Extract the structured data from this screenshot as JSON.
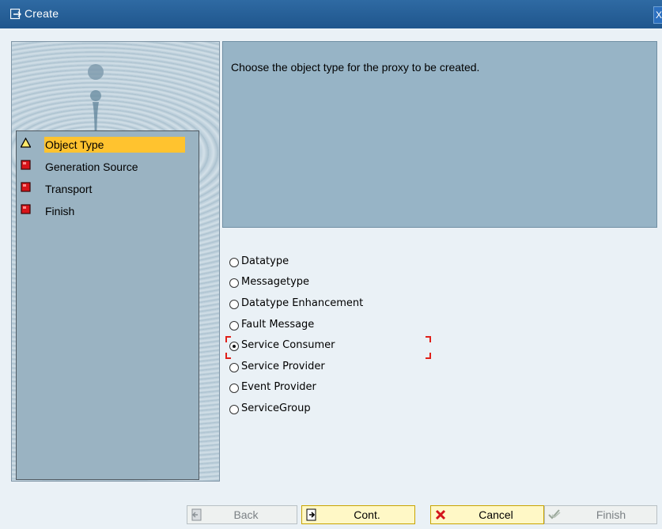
{
  "window": {
    "title": "Create",
    "close_glyph": "X"
  },
  "steps": {
    "items": [
      {
        "label": "Object Type",
        "status": "current",
        "icon": "warning-triangle-icon"
      },
      {
        "label": "Generation Source",
        "status": "pending",
        "icon": "red-square-icon"
      },
      {
        "label": "Transport",
        "status": "pending",
        "icon": "red-square-icon"
      },
      {
        "label": "Finish",
        "status": "pending",
        "icon": "red-square-icon"
      }
    ]
  },
  "description": {
    "text": "Choose the object type for the proxy to be created."
  },
  "object_types": {
    "options": [
      {
        "label": "Datatype",
        "selected": false
      },
      {
        "label": "Messagetype",
        "selected": false
      },
      {
        "label": "Datatype Enhancement",
        "selected": false
      },
      {
        "label": "Fault Message",
        "selected": false
      },
      {
        "label": "Service Consumer",
        "selected": true
      },
      {
        "label": "Service Provider",
        "selected": false
      },
      {
        "label": "Event Provider",
        "selected": false
      },
      {
        "label": "ServiceGroup",
        "selected": false
      }
    ]
  },
  "buttons": {
    "back": "Back",
    "cont": "Cont.",
    "cancel": "Cancel",
    "finish": "Finish"
  },
  "colors": {
    "title_bar": "#2f6aa3",
    "highlight": "#ffc32f",
    "panel": "#97b4c6",
    "focus": "#e0201a"
  }
}
